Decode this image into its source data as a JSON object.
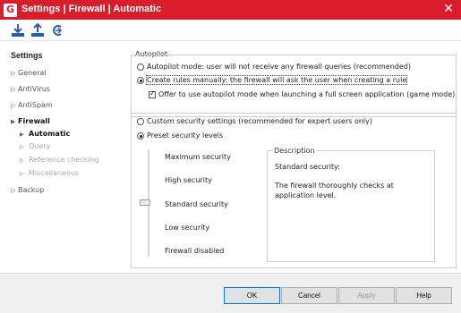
{
  "window": {
    "title": "Settings | Firewall | Automatic",
    "logo": "G"
  },
  "toolbar": {
    "icons": [
      "download-icon",
      "upload-icon",
      "reset-icon"
    ]
  },
  "sidebar": {
    "heading": "Settings",
    "items": [
      {
        "label": "General"
      },
      {
        "label": "AntiVirus"
      },
      {
        "label": "AntiSpam"
      },
      {
        "label": "Firewall"
      },
      {
        "label": "Backup"
      }
    ],
    "subitems": [
      {
        "label": "Automatic"
      },
      {
        "label": "Query"
      },
      {
        "label": "Reference checking"
      },
      {
        "label": "Miscellaneous"
      }
    ]
  },
  "autopilot": {
    "section_title": "Autopilot",
    "option_auto": "Autopilot mode: user will not receive any firewall queries (recommended)",
    "option_manual": "Create rules manually: the firewall will ask the user when creating a rule",
    "offer_checkbox": "Offer to use autopilot mode when launching a full screen application (game mode)"
  },
  "security": {
    "custom_option": "Custom security settings (recommended for expert users only)",
    "preset_option": "Preset security levels",
    "levels": [
      "Maximum security",
      "High security",
      "Standard security",
      "Low security",
      "Firewall disabled"
    ],
    "selected_level": "Standard security"
  },
  "description": {
    "legend": "Description",
    "title": "Standard security:",
    "body": "The firewall thoroughly checks at application level."
  },
  "footer": {
    "ok": "OK",
    "cancel": "Cancel",
    "apply": "Apply",
    "help": "Help"
  }
}
